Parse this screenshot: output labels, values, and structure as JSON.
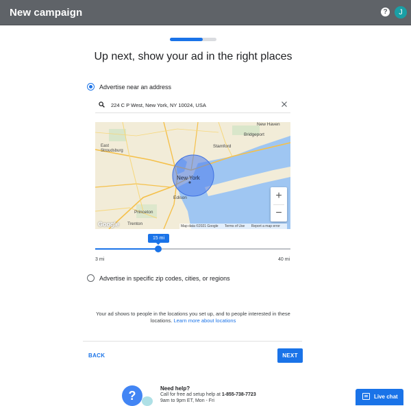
{
  "header": {
    "title": "New campaign",
    "help_icon": "?",
    "avatar_letter": "J"
  },
  "progress": {
    "fraction": 0.7
  },
  "heading": "Up next, show your ad in the right places",
  "options": {
    "address_label": "Advertise near an address",
    "zip_label": "Advertise in specific zip codes, cities, or regions",
    "selected": "address"
  },
  "search": {
    "value": "224 C P West, New York, NY 10024, USA"
  },
  "map": {
    "center_label": "New York",
    "labels": [
      "East Stroudsburg",
      "Stamford",
      "Bridgeport",
      "Edison",
      "Princeton",
      "Trenton",
      "New Haven"
    ],
    "footer": [
      "Map data ©2021 Google",
      "Terms of Use",
      "Report a map error"
    ],
    "logo": "Google",
    "zoom_in": "+",
    "zoom_out": "−",
    "colors": {
      "land": "#f2ecd8",
      "water": "#9fc6f2",
      "radius": "#4b7bec"
    }
  },
  "slider": {
    "value_label": "15 mi",
    "min_label": "3 mi",
    "max_label": "40 mi",
    "value": 15,
    "min": 3,
    "max": 40
  },
  "info": {
    "text": "Your ad shows to people in the locations you set up, and to people interested in these locations.",
    "link": "Learn more about locations"
  },
  "nav": {
    "back": "BACK",
    "next": "NEXT"
  },
  "help": {
    "title": "Need help?",
    "call_prefix": "Call for free ad setup help at ",
    "phone": "1-855-738-7723",
    "hours": "9am to 9pm ET, Mon - Fri",
    "icon": "?"
  },
  "live_chat": {
    "label": "Live chat"
  },
  "colors": {
    "accent": "#1a73e8",
    "topbar": "#5f6368",
    "avatar": "#1a9fa5"
  }
}
